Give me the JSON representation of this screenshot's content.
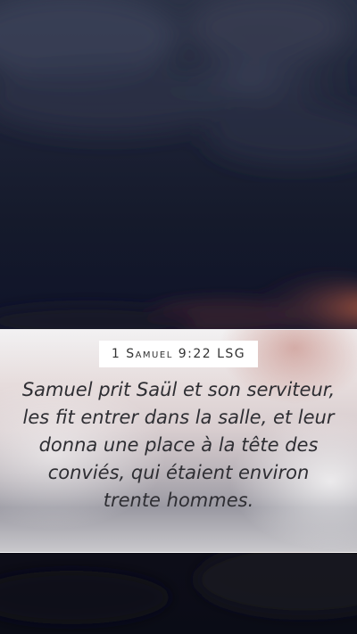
{
  "verse": {
    "reference": "1 Samuel 9:22 LSG",
    "text": "Samuel prit Saül et son serviteur, les fit entrer dans la salle, et leur donna une place à la tête des conviés, qui étaient environ trente hommes."
  },
  "colors": {
    "sky_top": "#2a3145",
    "sky_bottom": "#0a0c16",
    "sunset_glow": "#b25a40",
    "panel_base": "#e6e3e4",
    "verse_text": "#2e2e33"
  }
}
